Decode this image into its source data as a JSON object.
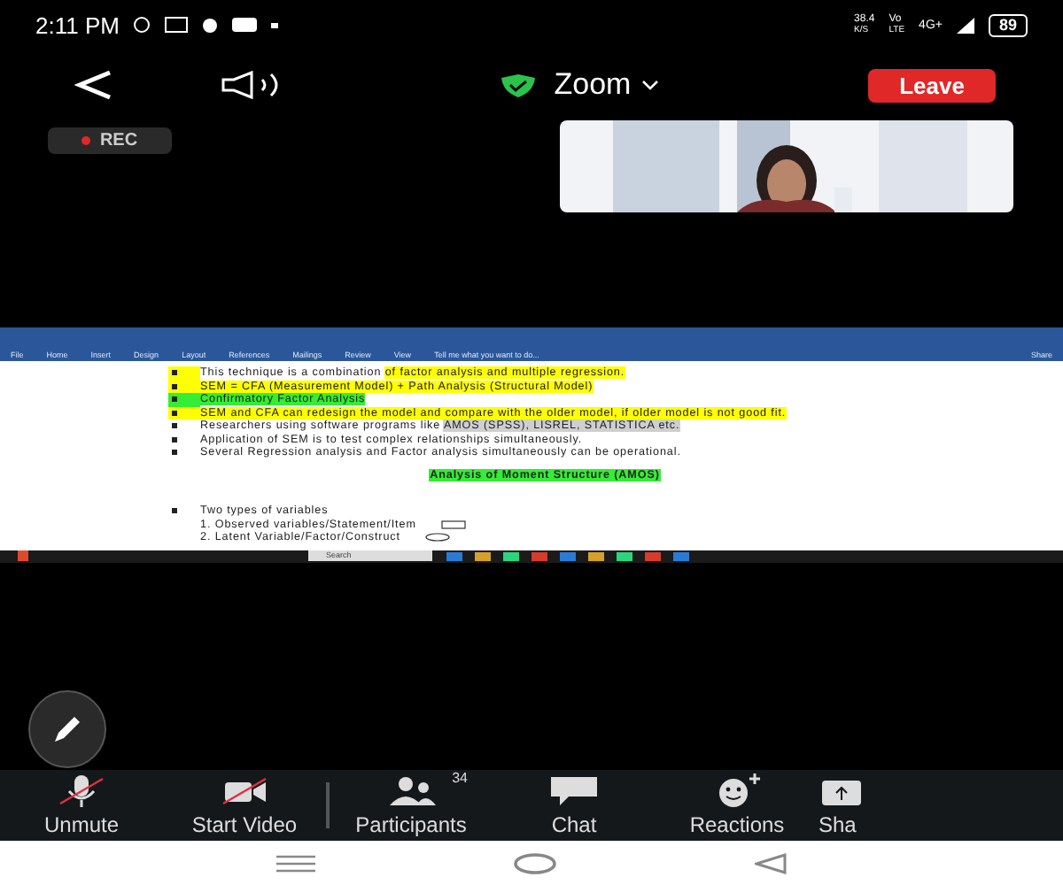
{
  "status_bar": {
    "time": "2:11 PM",
    "speed": "38.4",
    "speed_unit": "K/S",
    "volte": "Vo",
    "lte": "LTE",
    "network": "4G+",
    "battery": "89"
  },
  "top_bar": {
    "title": "Zoom",
    "leave": "Leave"
  },
  "recording": {
    "label": "REC"
  },
  "shared_document": {
    "ribbon_tabs": [
      {
        "label": "File",
        "selected": false
      },
      {
        "label": "Home",
        "selected": false
      },
      {
        "label": "Insert",
        "selected": false
      },
      {
        "label": "Design",
        "selected": false
      },
      {
        "label": "Layout",
        "selected": false
      },
      {
        "label": "References",
        "selected": false
      },
      {
        "label": "Mailings",
        "selected": false
      },
      {
        "label": "Review",
        "selected": false
      },
      {
        "label": "View",
        "selected": false
      }
    ],
    "search_hint": "Tell me what you want to do...",
    "share": "Share",
    "lines": [
      {
        "kind": "bullet",
        "bullet": {
          "color": "#ffff00"
        },
        "segments": [
          {
            "text": "This technique is a combination "
          },
          {
            "text": "of factor analysis and multiple regression.",
            "color": "#ffff00"
          }
        ]
      },
      {
        "kind": "bullet",
        "bullet": {
          "color": "#ffff00"
        },
        "segments": [
          {
            "text": "SEM = CFA (Measurement Model) + Path Analysis (Structural Model)",
            "color": "#ffff00"
          }
        ]
      },
      {
        "kind": "bullet",
        "bullet": {
          "color": "#33ee33"
        },
        "segments": [
          {
            "text": "Confirmatory Factor Analysis",
            "color": "#33ee33"
          }
        ]
      },
      {
        "kind": "bullet",
        "bullet": {
          "color": "#ffff00"
        },
        "segments": [
          {
            "text": "SEM and CFA can redesign the model and compare with the older model, if older model is not good fit.",
            "color": "#ffff00"
          }
        ]
      },
      {
        "kind": "bullet",
        "segments": [
          {
            "text": "Researchers using software programs like "
          },
          {
            "text": "AMOS (SPSS), LISREL, STATISTICA etc.",
            "color": "#cfcfcf"
          }
        ]
      },
      {
        "kind": "bullet",
        "segments": [
          {
            "text": "Application of SEM is to test complex relationships simultaneously."
          }
        ]
      },
      {
        "kind": "bullet",
        "segments": [
          {
            "text": "Several Regression analysis and Factor analysis simultaneously can be operational."
          }
        ]
      },
      {
        "kind": "heading",
        "text": "Analysis of Moment Structure (AMOS)",
        "color": "#33ee33"
      },
      {
        "kind": "bullet",
        "segments": [
          {
            "text": "Two types of variables"
          }
        ]
      },
      {
        "kind": "numbered",
        "number": "1.",
        "text": "Observed variables/Statement/Item",
        "shape": {
          "kind": "rectangle"
        }
      },
      {
        "kind": "numbered",
        "number": "2.",
        "text": "Latent Variable/Factor/Construct",
        "shape": {
          "kind": "ellipse"
        }
      }
    ],
    "taskbar_search": "Search"
  },
  "toolbar": [
    {
      "kind": "mic",
      "label": "Unmute"
    },
    {
      "kind": "video",
      "label": "Start Video"
    },
    {
      "kind": "participants",
      "label": "Participants",
      "count": "34"
    },
    {
      "kind": "chat",
      "label": "Chat"
    },
    {
      "kind": "reactions",
      "label": "Reactions"
    },
    {
      "kind": "share",
      "label": "Sha"
    }
  ]
}
